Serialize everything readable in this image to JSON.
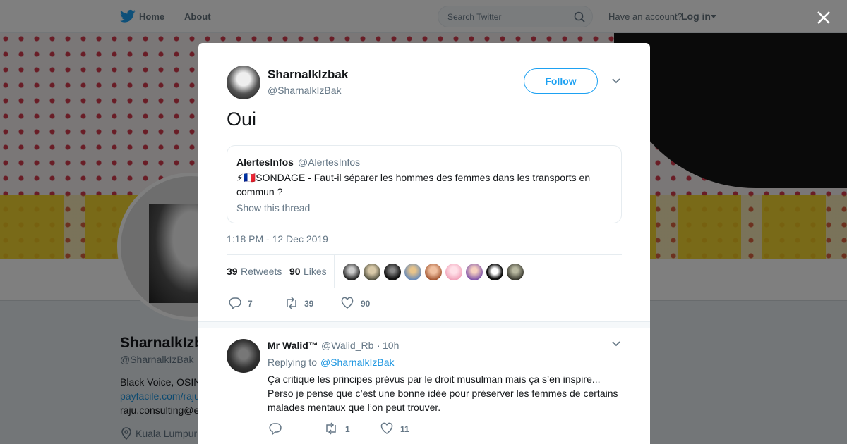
{
  "nav": {
    "home": "Home",
    "about": "About",
    "search_placeholder": "Search Twitter",
    "have_account": "Have an account?",
    "login": "Log in"
  },
  "profile": {
    "name": "SharnalkIzbak",
    "handle": "@SharnalkIzBak",
    "bio": "Black Voice, OSIN",
    "link": "payfacile.com/raju",
    "email": "raju.consulting@e",
    "location": "Kuala Lumpur"
  },
  "tweet": {
    "author_name": "SharnalkIzbak",
    "author_handle": "@SharnalkIzBak",
    "follow_label": "Follow",
    "text": "Oui",
    "quote": {
      "name": "AlertesInfos",
      "handle": "@AlertesInfos",
      "text": "⚡🇫🇷SONDAGE - Faut-il séparer les hommes des femmes dans les transports en commun ?",
      "show_thread": "Show this thread"
    },
    "timestamp": "1:18 PM - 12 Dec 2019",
    "retweets_count": "39",
    "retweets_label": "Retweets",
    "likes_count": "90",
    "likes_label": "Likes",
    "reply_count": "7",
    "retweet_action_count": "39",
    "like_action_count": "90"
  },
  "reply": {
    "name": "Mr Walid™",
    "handle": "@Walid_Rb",
    "dot": "·",
    "time": "10h",
    "replying_prefix": "Replying to",
    "replying_to": "@SharnalkIzBak",
    "text": "Ça critique les principes prévus par le droit musulman mais ça s’en inspire... Perso je pense que c’est une bonne idée pour préserver les femmes de certains malades mentaux que l’on peut trouver.",
    "reply_count": "",
    "retweet_count": "1",
    "like_count": "11"
  },
  "colors": {
    "accent": "#1da1f2",
    "link": "#1b95e0",
    "muted": "#657786"
  }
}
